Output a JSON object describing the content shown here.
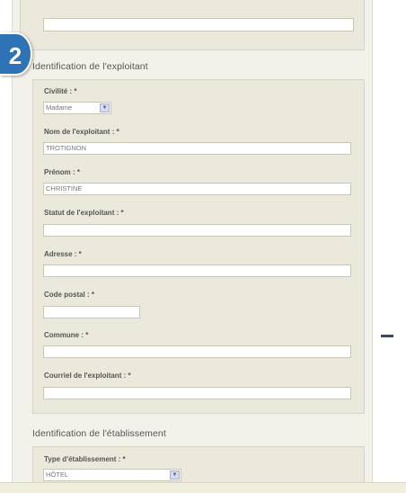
{
  "step_number": "2",
  "section_exploitant": {
    "legend": "Identification de l'exploitant",
    "civilite": {
      "label": "Civilité : *",
      "value": "Madame"
    },
    "nom": {
      "label": "Nom de l'exploitant : *",
      "value": "TROTIGNON"
    },
    "prenom": {
      "label": "Prénom : *",
      "value": "CHRISTINE"
    },
    "statut": {
      "label": "Statut de l'exploitant : *",
      "value": ""
    },
    "adresse": {
      "label": "Adresse : *",
      "value": ""
    },
    "code_postal": {
      "label": "Code postal : *",
      "value": ""
    },
    "commune": {
      "label": "Commune : *",
      "value": ""
    },
    "courriel": {
      "label": "Courriel de l'exploitant : *",
      "value": ""
    }
  },
  "section_etablissement": {
    "legend": "Identification de l'établissement",
    "type": {
      "label": "Type d'établissement : *",
      "value": "HÔTEL"
    }
  },
  "colors": {
    "badge": "#2f73b7",
    "panel": "#f2f1ea",
    "fieldset": "#ebe9dc"
  }
}
